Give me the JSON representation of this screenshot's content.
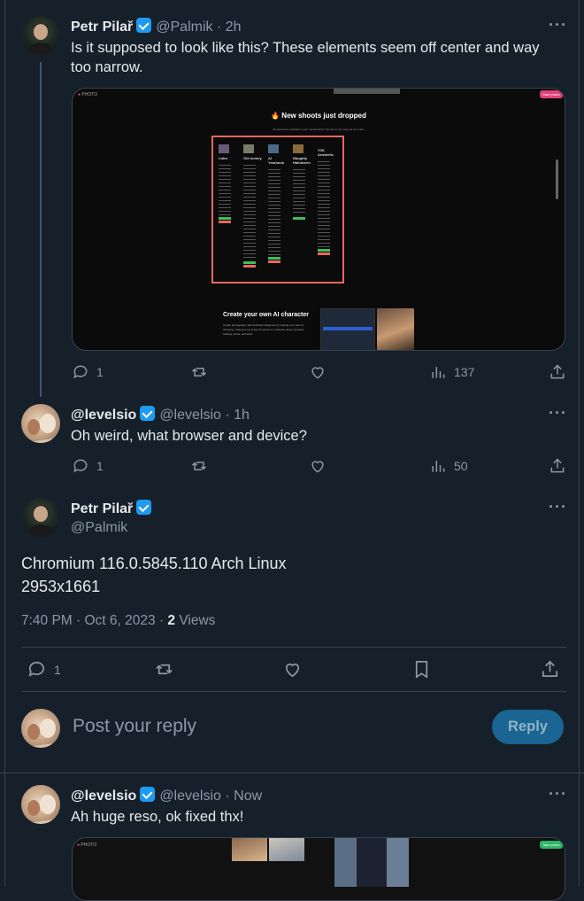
{
  "tweet1": {
    "name": "Petr Pilař",
    "handle": "@Palmik",
    "time": "2h",
    "text_line1": "Is it supposed to look like this? These elements seem off center and way",
    "text_line2": "too narrow.",
    "replies": "1",
    "views": "137",
    "media": {
      "brand": "PHOTO",
      "top_button": "Start photo",
      "heading": "🔥 New shoots just dropped",
      "subheading": "All shoots are included in your membership! You can try as many as you want.",
      "columns": [
        {
          "title": "Latex",
          "emoji": "🎭"
        },
        {
          "title": "Old money",
          "emoji": "🎩"
        },
        {
          "title": "AI Yearbook",
          "emoji": "📓"
        },
        {
          "title": "Naughty Halloween",
          "emoji": "🎃"
        },
        {
          "title": "Y2K Aesthetic",
          "emoji": "💿"
        }
      ],
      "section_title": "Create your own AI character",
      "section_body": "Create photography with artificial intelligence by training your own AI character. Upload a set of just 10 photos in a diverse range of places, settings, times, and attire."
    }
  },
  "tweet2": {
    "name": "@levelsio",
    "handle": "@levelsio",
    "time": "1h",
    "text": "Oh weird, what browser and device?",
    "replies": "1",
    "views": "50"
  },
  "main": {
    "name": "Petr Pilař",
    "handle": "@Palmik",
    "text_line1": "Chromium 116.0.5845.110 Arch Linux",
    "text_line2": "2953x1661",
    "timestamp": "7:40 PM · Oct 6, 2023 · ",
    "views_count": "2",
    "views_label": " Views",
    "replies": "1"
  },
  "reply_box": {
    "placeholder": "Post your reply",
    "button": "Reply"
  },
  "tweet3": {
    "name": "@levelsio",
    "handle": "@levelsio",
    "time": "Now",
    "text": "Ah huge reso, ok fixed thx!",
    "media": {
      "brand": "PHOTO",
      "button": "Take photo"
    }
  },
  "colors": {
    "background": "#15202b",
    "accent": "#1d9bf0",
    "muted": "#8b98a5"
  }
}
